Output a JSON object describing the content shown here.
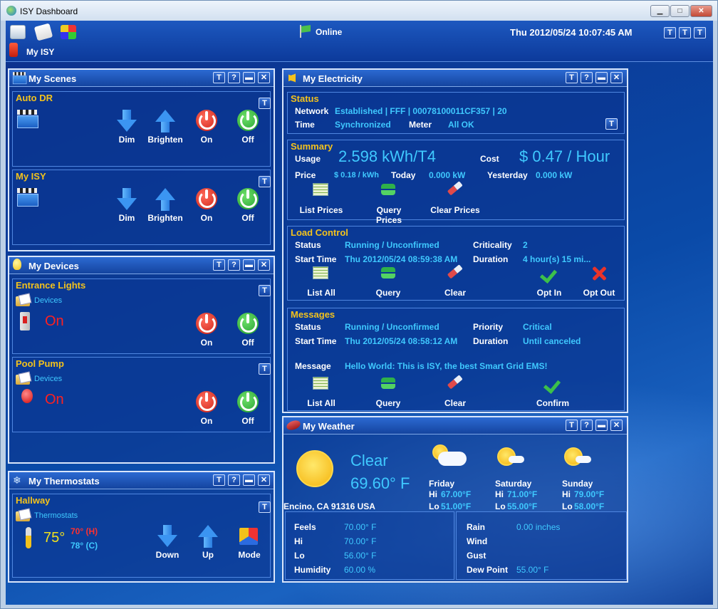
{
  "window": {
    "title": "ISY Dashboard"
  },
  "toolbar": {
    "status": "Online",
    "datetime": "Thu 2012/05/24 10:07:45 AM",
    "myisy": "My ISY"
  },
  "scenes": {
    "title": "My Scenes",
    "items": [
      {
        "name": "Auto DR",
        "dim": "Dim",
        "brighten": "Brighten",
        "on": "On",
        "off": "Off"
      },
      {
        "name": "My ISY",
        "dim": "Dim",
        "brighten": "Brighten",
        "on": "On",
        "off": "Off"
      }
    ]
  },
  "devices": {
    "title": "My Devices",
    "items": [
      {
        "name": "Entrance Lights",
        "folder": "Devices",
        "state": "On",
        "on": "On",
        "off": "Off"
      },
      {
        "name": "Pool Pump",
        "folder": "Devices",
        "state": "On",
        "on": "On",
        "off": "Off"
      }
    ]
  },
  "thermostats": {
    "title": "My Thermostats",
    "name": "Hallway",
    "folder": "Thermostats",
    "temp": "75°",
    "heat": "70° (H)",
    "cool": "78° (C)",
    "down": "Down",
    "up": "Up",
    "mode": "Mode"
  },
  "electricity": {
    "title": "My Electricity",
    "status": {
      "title": "Status",
      "network_label": "Network",
      "network": "Established | FFF | 00078100011CF357 | 20",
      "time_label": "Time",
      "time": "Synchronized",
      "meter_label": "Meter",
      "meter": "All OK"
    },
    "summary": {
      "title": "Summary",
      "usage_label": "Usage",
      "usage": "2.598 kWh/T4",
      "cost_label": "Cost",
      "cost": "$ 0.47 / Hour",
      "price_label": "Price",
      "price": "$ 0.18 / kWh",
      "today_label": "Today",
      "today": "0.000 kW",
      "yesterday_label": "Yesterday",
      "yesterday": "0.000 kW",
      "list_prices": "List Prices",
      "query_prices": "Query Prices",
      "clear_prices": "Clear Prices"
    },
    "load": {
      "title": "Load Control",
      "status_label": "Status",
      "status": "Running / Unconfirmed",
      "criticality_label": "Criticality",
      "criticality": "2",
      "start_label": "Start Time",
      "start": "Thu 2012/05/24 08:59:38 AM",
      "duration_label": "Duration",
      "duration": "4 hour(s) 15 mi...",
      "list_all": "List All",
      "query": "Query",
      "clear": "Clear",
      "opt_in": "Opt In",
      "opt_out": "Opt Out"
    },
    "messages": {
      "title": "Messages",
      "status_label": "Status",
      "status": "Running / Unconfirmed",
      "priority_label": "Priority",
      "priority": "Critical",
      "start_label": "Start Time",
      "start": "Thu 2012/05/24 08:58:12 AM",
      "duration_label": "Duration",
      "duration": "Until canceled",
      "message_label": "Message",
      "message": "Hello World: This is ISY, the best Smart Grid EMS!",
      "list_all": "List All",
      "query": "Query",
      "clear": "Clear",
      "confirm": "Confirm"
    }
  },
  "weather": {
    "title": "My Weather",
    "condition": "Clear",
    "temp": "69.60° F",
    "location": "Encino,  CA 91316 USA",
    "forecast": [
      {
        "day": "Friday",
        "hi": "67.00°F",
        "lo": "51.00°F"
      },
      {
        "day": "Saturday",
        "hi": "71.00°F",
        "lo": "55.00°F"
      },
      {
        "day": "Sunday",
        "hi": "79.00°F",
        "lo": "58.00°F"
      }
    ],
    "hi_label": "Hi",
    "lo_label": "Lo",
    "feels_label": "Feels",
    "feels": "70.00° F",
    "hi": "70.00° F",
    "lo": "56.00° F",
    "humidity_label": "Humidity",
    "humidity": "60.00 %",
    "rain_label": "Rain",
    "rain": "0.00 inches",
    "wind_label": "Wind",
    "gust_label": "Gust",
    "dewpoint_label": "Dew Point",
    "dewpoint": "55.00° F"
  }
}
